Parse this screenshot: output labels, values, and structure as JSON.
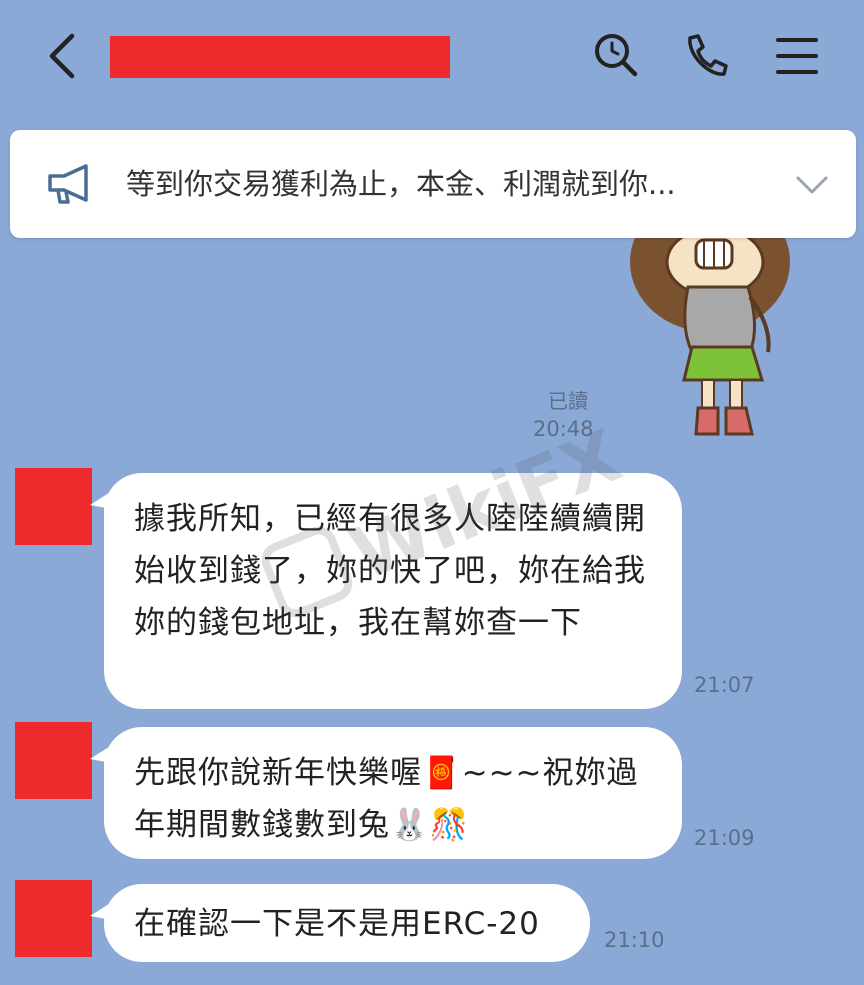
{
  "header": {
    "back_icon": "chevron-left-icon",
    "actions": [
      "search-icon",
      "phone-icon",
      "menu-icon"
    ]
  },
  "notice": {
    "icon": "megaphone-icon",
    "text": "等到你交易獲利為止，本金、利潤就到你...",
    "expand_icon": "chevron-down-icon"
  },
  "status": {
    "read": "已讀",
    "read_time": "20:48"
  },
  "messages": [
    {
      "text": "據我所知，已經有很多人陸陸續續開始收到錢了，妳的快了吧，妳在給我妳的錢包地址，我在幫妳查一下",
      "time": "21:07"
    },
    {
      "text": "先跟你說新年快樂喔🧧~~~祝妳過年期間數錢數到兔🐰🎊",
      "time": "21:09"
    },
    {
      "text": "在確認一下是不是用ERC-20",
      "time": "21:10"
    }
  ],
  "watermark": "WikiFX",
  "colors": {
    "background": "#8aa9d6",
    "bubble": "#ffffff",
    "redaction": "#ee2a2d"
  }
}
